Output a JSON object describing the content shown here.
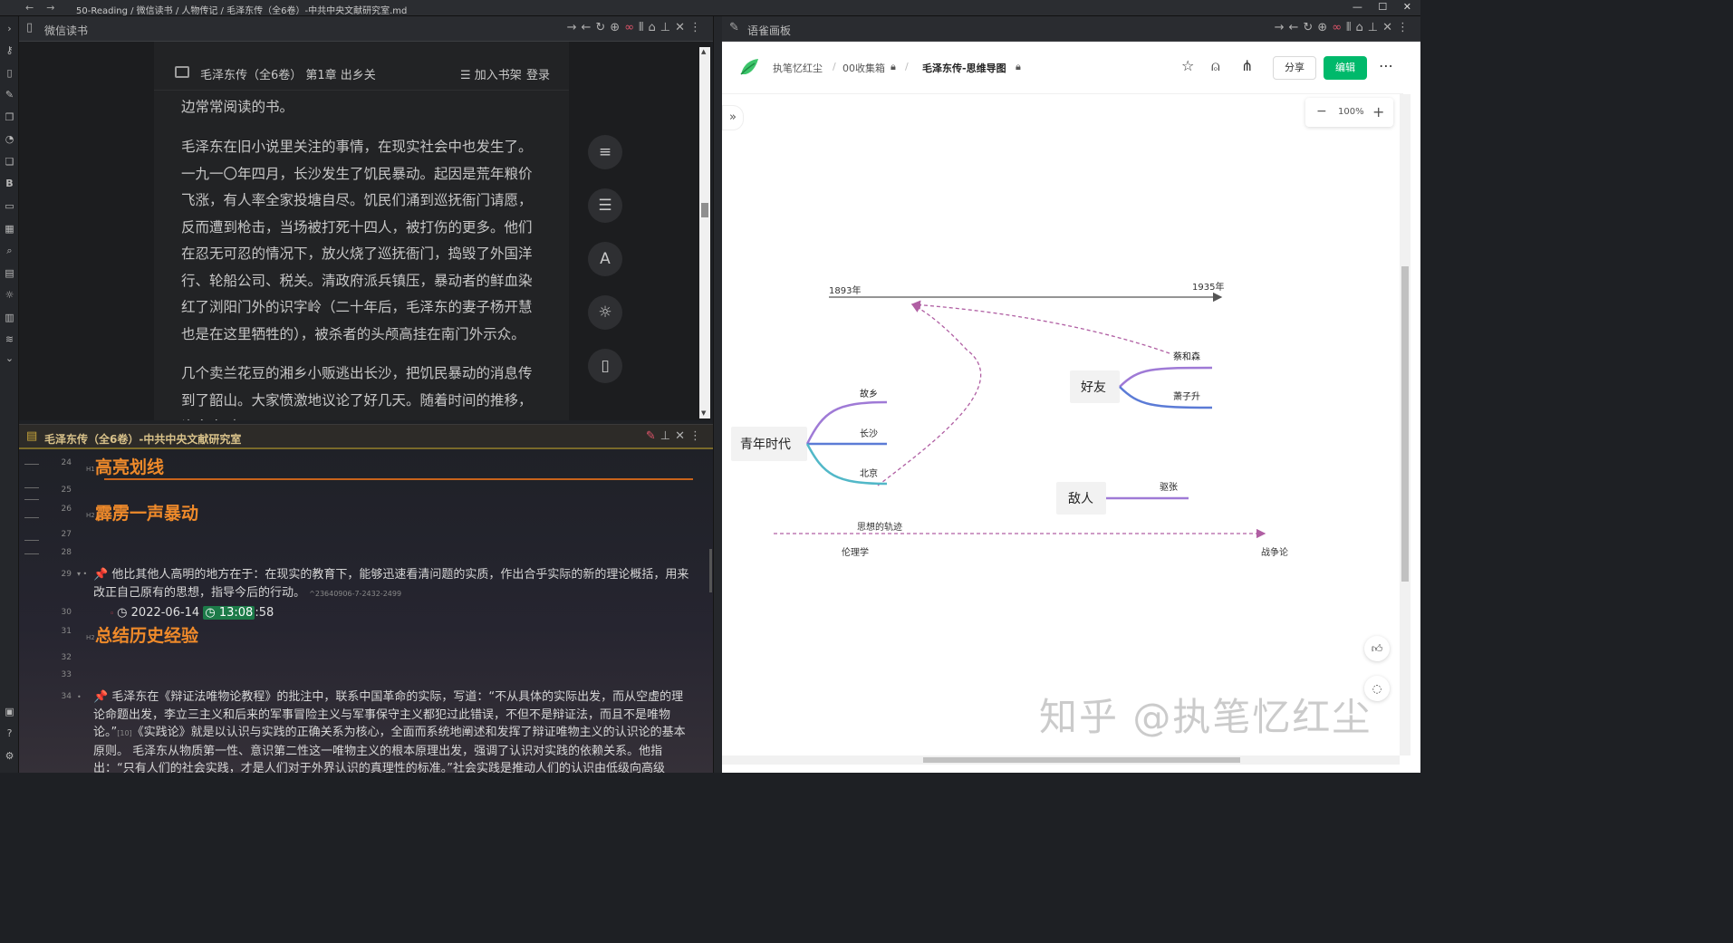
{
  "titlebar": {
    "path": "50-Reading / 微信读书 / 人物传记 / 毛泽东传（全6卷）-中共中央文献研究室.md",
    "back": "←",
    "forward": "→",
    "minimize": "—",
    "maximize": "☐",
    "close": "✕"
  },
  "reader_pane": {
    "title": "微信读书",
    "book_header": "毛泽东传（全6卷） 第1章 出乡关",
    "add_shelf": "加入书架",
    "login": "登录",
    "paragraphs": [
      "边常常阅读的书。",
      "毛泽东在旧小说里关注的事情，在现实社会中也发生了。一九一〇年四月，长沙发生了饥民暴动。起因是荒年粮价飞涨，有人率全家投塘自尽。饥民们涌到巡抚衙门请愿，反而遭到枪击，当场被打死十四人，被打伤的更多。他们在忍无可忍的情况下，放火烧了巡抚衙门，捣毁了外国洋行、轮船公司、税关。清政府派兵镇压，暴动者的鲜血染红了浏阳门外的识字岭（二十年后，毛泽东的妻子杨开慧也是在这里牺牲的），被杀者的头颅高挂在南门外示众。",
      "几个卖兰花豆的湘乡小贩逃出长沙，把饥民暴动的消息传到了韶山。大家愤激地议论了好几天。随着时间的推移，许多人对"
    ],
    "font_button": "A"
  },
  "note_pane": {
    "title": "毛泽东传（全6卷）-中共中央文献研究室",
    "line_numbers": [
      "24",
      "25",
      "26",
      "27",
      "28",
      "29",
      "30",
      "31",
      "32",
      "33",
      "34"
    ],
    "h1_marker": "H1",
    "h2_marker": "H2",
    "heading1": "高亮划线",
    "heading2a": "霹雳一声暴动",
    "heading2b": "总结历史经验",
    "pin": "📌",
    "para1": "他比其他人高明的地方在于：在现实的教育下，能够迅速看清问题的实质，作出合乎实际的新的理论概括，用来改正自己原有的思想，指导今后的行动。",
    "para1_id": "^23640906-7-2432-2499",
    "date": "2022-06-14",
    "time_hl": "13:08",
    "time_rest": ":58",
    "para2_a": "毛泽东在《辩证法唯物论教程》的批注中，联系中国革命的实际，写道：“不从具体的实际出发，而从空虚的理论命题出发，李立三主义和后来的军事冒险主义与军事保守主义都犯过此错误，不但不是辩证法，而且不是唯物论。”",
    "para2_id": "[10]",
    "para2_b": "《实践论》就是以认识与实践的正确关系为核心，全面而系统地阐述和发挥了辩证唯物主义的认识论的基本原则。  毛泽东从物质第一性、意识第二性这一唯物主义的根本原理出发，强调了认识对实践的依赖关系。他指出：“只有人们的社会实践，才是人们对于外界认识的真理性的标准。”社会实践是推动人们的认识由低级向高级"
  },
  "right_pane": {
    "title": "语雀画板",
    "breadcrumb": [
      "执笔忆红尘",
      "00收集箱",
      "毛泽东传-思维导图"
    ],
    "share": "分享",
    "edit": "编辑",
    "zoom": "100%",
    "zoom_minus": "−",
    "zoom_plus": "+",
    "brand_color": "#00b96b"
  },
  "mindmap": {
    "timeline_start": "1893年",
    "timeline_end": "1935年",
    "youth": "青年时代",
    "youth_children": [
      "故乡",
      "长沙",
      "北京"
    ],
    "friends": "好友",
    "friends_children": [
      "蔡和森",
      "萧子升"
    ],
    "enemy": "敌人",
    "enemy_children": [
      "驱张"
    ],
    "track_label": "思想的轨迹",
    "track_start": "伦理学",
    "track_end": "战争论"
  },
  "watermark": "知乎 @执笔忆红尘"
}
